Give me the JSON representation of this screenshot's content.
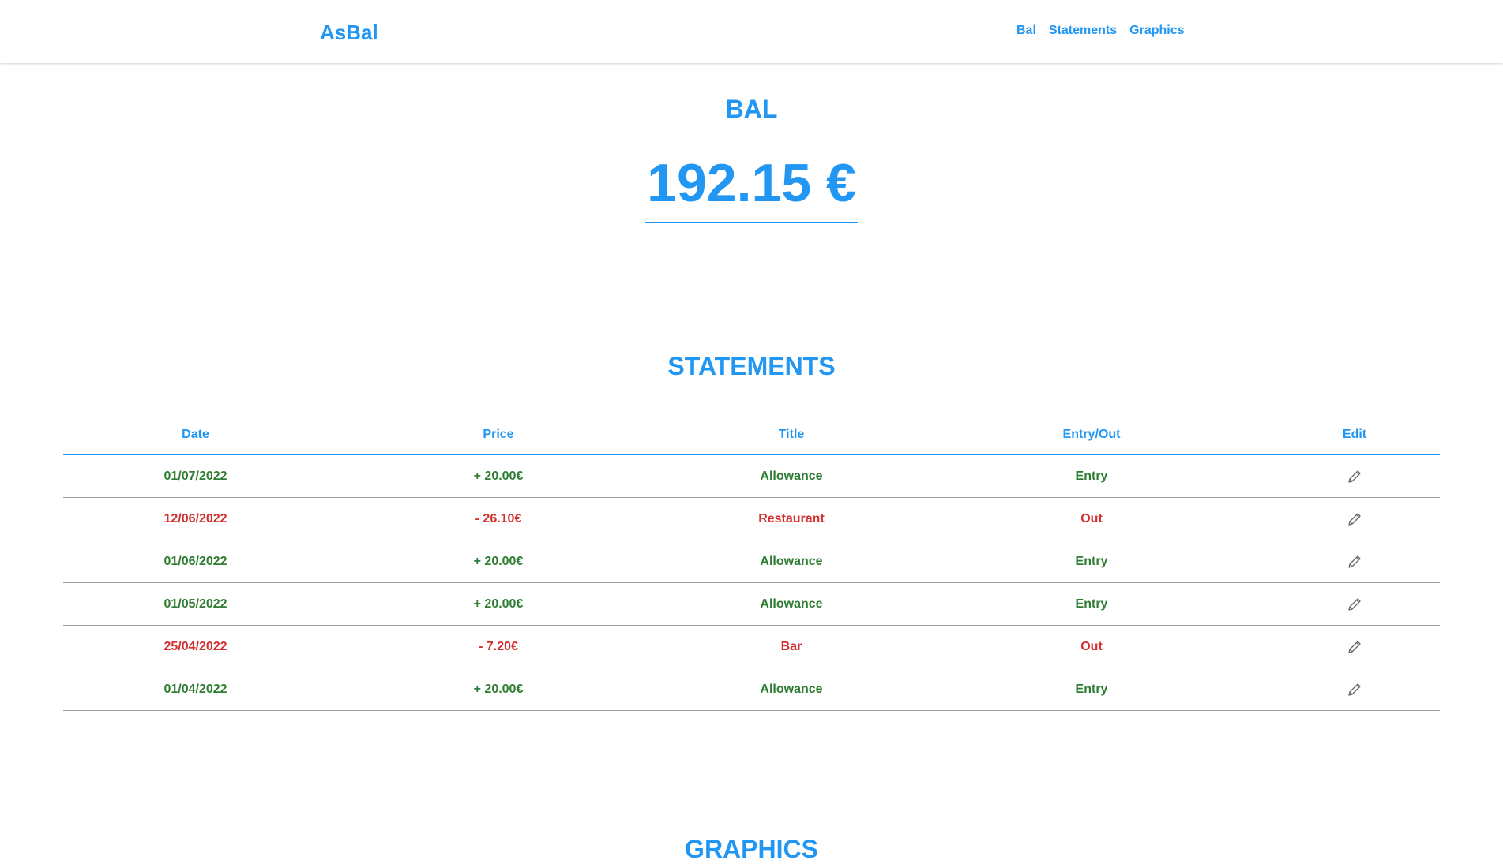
{
  "navbar": {
    "brand": "AsBal",
    "links": [
      {
        "label": "Bal"
      },
      {
        "label": "Statements"
      },
      {
        "label": "Graphics"
      }
    ]
  },
  "balance": {
    "title": "BAL",
    "amount": "192.15 €"
  },
  "statements": {
    "title": "STATEMENTS",
    "columns": [
      "Date",
      "Price",
      "Title",
      "Entry/Out",
      "Edit"
    ],
    "rows": [
      {
        "date": "01/07/2022",
        "price": "+ 20.00€",
        "title": "Allowance",
        "type": "Entry"
      },
      {
        "date": "12/06/2022",
        "price": "- 26.10€",
        "title": "Restaurant",
        "type": "Out"
      },
      {
        "date": "01/06/2022",
        "price": "+ 20.00€",
        "title": "Allowance",
        "type": "Entry"
      },
      {
        "date": "01/05/2022",
        "price": "+ 20.00€",
        "title": "Allowance",
        "type": "Entry"
      },
      {
        "date": "25/04/2022",
        "price": "- 7.20€",
        "title": "Bar",
        "type": "Out"
      },
      {
        "date": "01/04/2022",
        "price": "+ 20.00€",
        "title": "Allowance",
        "type": "Entry"
      }
    ],
    "edit_icon": "pencil-icon"
  },
  "graphics": {
    "title": "GRAPHICS"
  },
  "colors": {
    "accent": "#2196f3",
    "entry": "#2e7d32",
    "out": "#d32f2f"
  }
}
